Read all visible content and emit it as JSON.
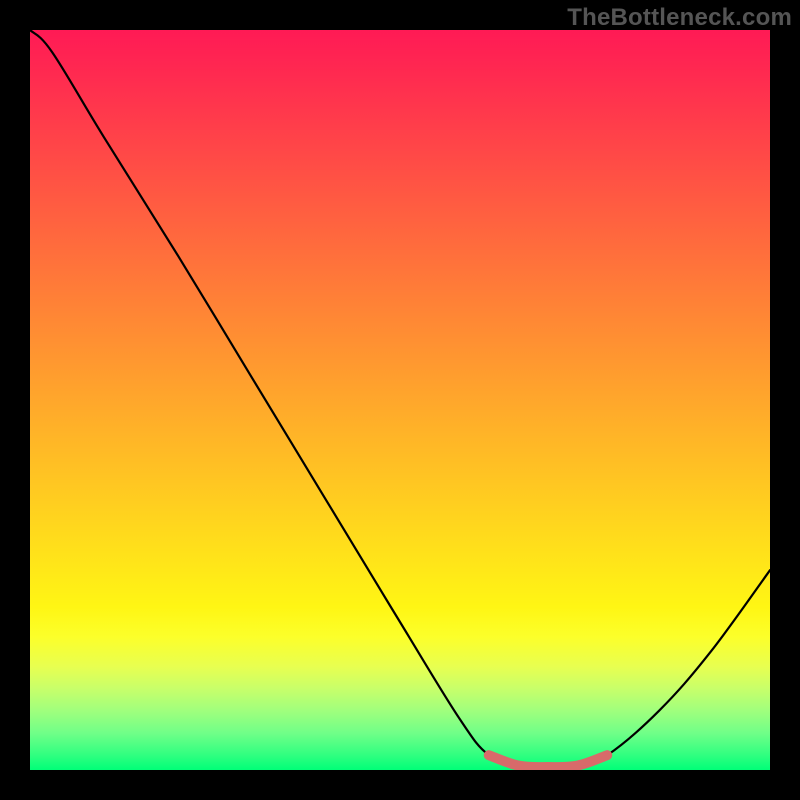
{
  "watermark": "TheBottleneck.com",
  "chart_data": {
    "type": "line",
    "title": "",
    "xlabel": "",
    "ylabel": "",
    "xlim": [
      0,
      100
    ],
    "ylim": [
      0,
      100
    ],
    "grid": false,
    "legend": false,
    "annotations": [],
    "series": [
      {
        "name": "main-curve",
        "color": "#000000",
        "x": [
          0,
          3,
          10,
          20,
          30,
          40,
          50,
          58,
          62,
          66,
          70,
          74,
          78,
          85,
          92,
          100
        ],
        "y": [
          100,
          97,
          85.5,
          69.5,
          53,
          36.5,
          20,
          7,
          2,
          0.6,
          0.4,
          0.6,
          2,
          8,
          16,
          27
        ]
      },
      {
        "name": "highlight-band",
        "color": "#d86a6a",
        "x": [
          62,
          66,
          70,
          74,
          78
        ],
        "y": [
          2,
          0.6,
          0.4,
          0.6,
          2
        ]
      }
    ],
    "background_gradient": {
      "direction": "top-to-bottom",
      "stops": [
        {
          "pos": 0,
          "color": "#ff1a55"
        },
        {
          "pos": 50,
          "color": "#ffb228"
        },
        {
          "pos": 80,
          "color": "#fff614"
        },
        {
          "pos": 100,
          "color": "#00ff78"
        }
      ]
    }
  }
}
